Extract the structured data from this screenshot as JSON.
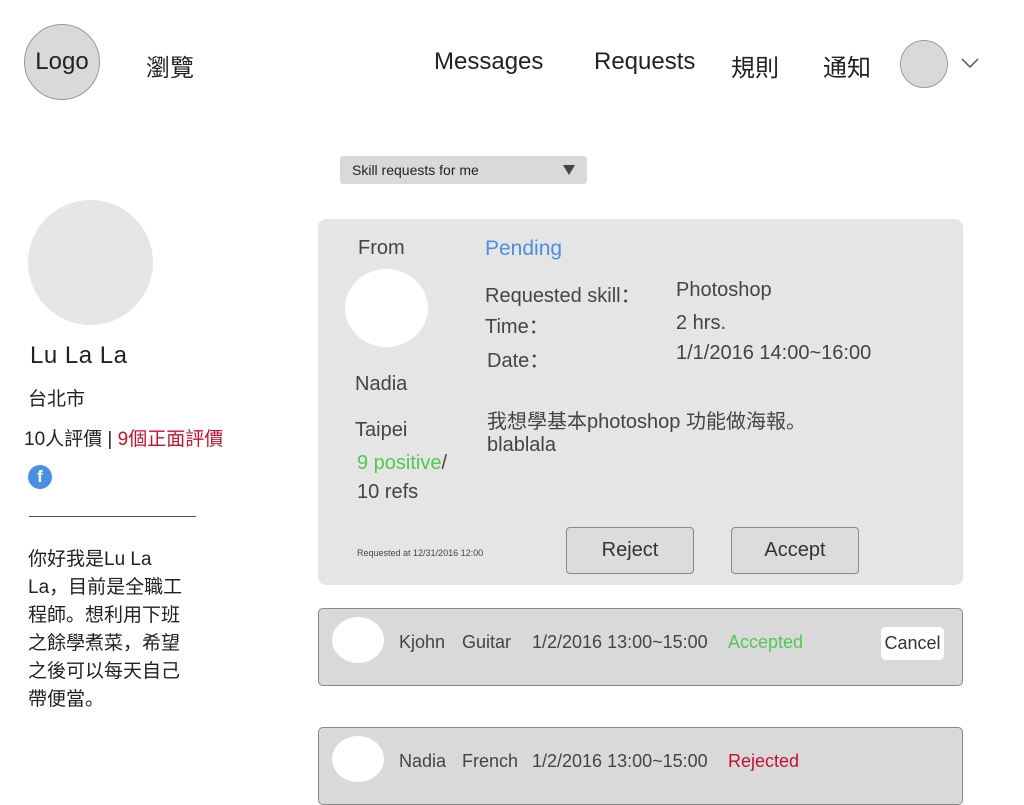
{
  "header": {
    "logo": "Logo",
    "browse": "瀏覽",
    "nav": {
      "messages": "Messages",
      "requests": "Requests",
      "rules": "規則",
      "notifications": "通知"
    }
  },
  "profile": {
    "name": "Lu La La",
    "city": "台北市",
    "ratings_count": "10人評價",
    "separator": "|",
    "ratings_positive": "9個正面評價",
    "facebook_glyph": "f",
    "bio_lines": [
      "你好我是Lu La",
      "La，目前是全職工",
      "程師。想利用下班",
      "之餘學煮菜，希望",
      "之後可以每天自己",
      "帶便當。"
    ]
  },
  "filter": {
    "selected": "Skill requests for me"
  },
  "pending_request": {
    "from_label": "From",
    "status": "Pending",
    "requester_name": "Nadia",
    "requester_city": "Taipei",
    "positive": "9 positive",
    "slash": "/",
    "refs": "10 refs",
    "skill_label": "Requested skill：",
    "skill_value": "Photoshop",
    "time_label": "Time：",
    "time_value": "2 hrs.",
    "date_label": "Date：",
    "date_value": "1/1/2016 14:00~16:00",
    "message_line1": "我想學基本photoshop 功能做海報。",
    "message_line2": "blablala",
    "requested_at": "Requested at 12/31/2016 12:00",
    "reject_label": "Reject",
    "accept_label": "Accept"
  },
  "rows": [
    {
      "name": "Kjohn",
      "skill": "Guitar",
      "datetime": "1/2/2016 13:00~15:00",
      "status": "Accepted",
      "action": "Cancel",
      "status_color": "#52c852"
    },
    {
      "name": "Nadia",
      "skill": "French",
      "datetime": "1/2/2016 13:00~15:00",
      "status": "Rejected",
      "status_color": "#c8102e"
    }
  ]
}
